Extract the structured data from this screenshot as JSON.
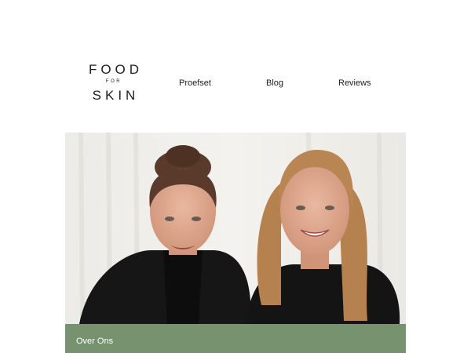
{
  "logo": {
    "line1": "FOOD",
    "line2": "FOR",
    "line3": "SKIN"
  },
  "nav": [
    {
      "label": "Proefset"
    },
    {
      "label": "Blog"
    },
    {
      "label": "Reviews"
    }
  ],
  "hero": {
    "image_description": "two-women-portrait"
  },
  "banner": {
    "label": "Over Ons",
    "color": "#77926f"
  }
}
